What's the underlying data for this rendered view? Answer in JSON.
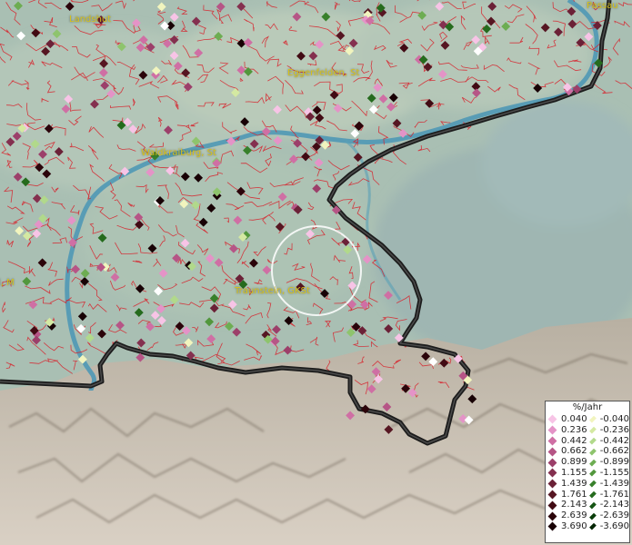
{
  "places": {
    "landshut": "Landshut",
    "passau": "Passau",
    "eggenfelden": "Eggenfelden, St",
    "waldkraiburg": "Waldkraiburg, St",
    "traunstein": "Traunstein, GKSt",
    "left_edge": "l, M"
  },
  "legend": {
    "unit": "%/Jahr",
    "positive": [
      "0.040",
      "0.236",
      "0.442",
      "0.662",
      "0.899",
      "1.155",
      "1.439",
      "1.761",
      "2.143",
      "2.639",
      "3.690"
    ],
    "negative": [
      "-0.040",
      "-0.236",
      "-0.442",
      "-0.662",
      "-0.899",
      "-1.155",
      "-1.439",
      "-1.761",
      "-2.143",
      "-2.639",
      "-3.690"
    ],
    "positive_colors": [
      "#f7c4e6",
      "#e493c7",
      "#cf6fa4",
      "#b65586",
      "#9c3f6a",
      "#84304f",
      "#6b2137",
      "#561622",
      "#410a13",
      "#2b040a",
      "#180105"
    ],
    "negative_colors": [
      "#f1f4be",
      "#d4e9a2",
      "#b1d98b",
      "#8ec46d",
      "#6dad52",
      "#52973d",
      "#38802b",
      "#256b1d",
      "#155413",
      "#0a3d0a",
      "#052505"
    ]
  }
}
